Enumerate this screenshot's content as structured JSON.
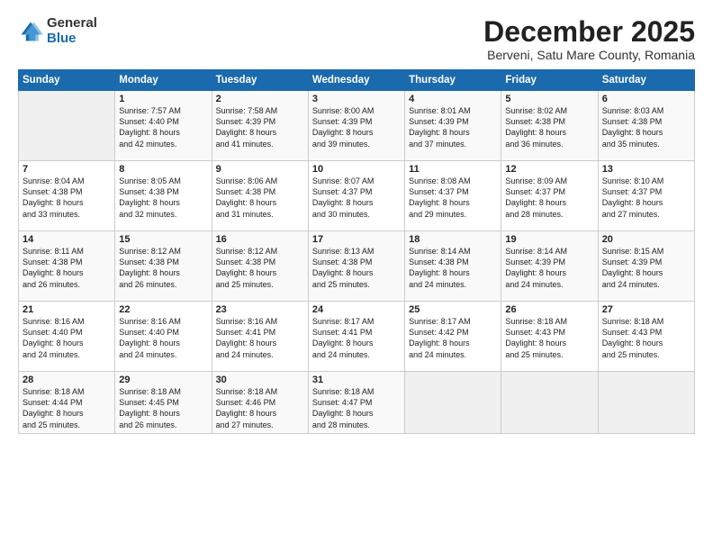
{
  "header": {
    "logo_general": "General",
    "logo_blue": "Blue",
    "month_title": "December 2025",
    "location": "Berveni, Satu Mare County, Romania"
  },
  "days_of_week": [
    "Sunday",
    "Monday",
    "Tuesday",
    "Wednesday",
    "Thursday",
    "Friday",
    "Saturday"
  ],
  "weeks": [
    [
      {
        "date": "",
        "text": ""
      },
      {
        "date": "1",
        "text": "Sunrise: 7:57 AM\nSunset: 4:40 PM\nDaylight: 8 hours\nand 42 minutes."
      },
      {
        "date": "2",
        "text": "Sunrise: 7:58 AM\nSunset: 4:39 PM\nDaylight: 8 hours\nand 41 minutes."
      },
      {
        "date": "3",
        "text": "Sunrise: 8:00 AM\nSunset: 4:39 PM\nDaylight: 8 hours\nand 39 minutes."
      },
      {
        "date": "4",
        "text": "Sunrise: 8:01 AM\nSunset: 4:39 PM\nDaylight: 8 hours\nand 37 minutes."
      },
      {
        "date": "5",
        "text": "Sunrise: 8:02 AM\nSunset: 4:38 PM\nDaylight: 8 hours\nand 36 minutes."
      },
      {
        "date": "6",
        "text": "Sunrise: 8:03 AM\nSunset: 4:38 PM\nDaylight: 8 hours\nand 35 minutes."
      }
    ],
    [
      {
        "date": "7",
        "text": "Sunrise: 8:04 AM\nSunset: 4:38 PM\nDaylight: 8 hours\nand 33 minutes."
      },
      {
        "date": "8",
        "text": "Sunrise: 8:05 AM\nSunset: 4:38 PM\nDaylight: 8 hours\nand 32 minutes."
      },
      {
        "date": "9",
        "text": "Sunrise: 8:06 AM\nSunset: 4:38 PM\nDaylight: 8 hours\nand 31 minutes."
      },
      {
        "date": "10",
        "text": "Sunrise: 8:07 AM\nSunset: 4:37 PM\nDaylight: 8 hours\nand 30 minutes."
      },
      {
        "date": "11",
        "text": "Sunrise: 8:08 AM\nSunset: 4:37 PM\nDaylight: 8 hours\nand 29 minutes."
      },
      {
        "date": "12",
        "text": "Sunrise: 8:09 AM\nSunset: 4:37 PM\nDaylight: 8 hours\nand 28 minutes."
      },
      {
        "date": "13",
        "text": "Sunrise: 8:10 AM\nSunset: 4:37 PM\nDaylight: 8 hours\nand 27 minutes."
      }
    ],
    [
      {
        "date": "14",
        "text": "Sunrise: 8:11 AM\nSunset: 4:38 PM\nDaylight: 8 hours\nand 26 minutes."
      },
      {
        "date": "15",
        "text": "Sunrise: 8:12 AM\nSunset: 4:38 PM\nDaylight: 8 hours\nand 26 minutes."
      },
      {
        "date": "16",
        "text": "Sunrise: 8:12 AM\nSunset: 4:38 PM\nDaylight: 8 hours\nand 25 minutes."
      },
      {
        "date": "17",
        "text": "Sunrise: 8:13 AM\nSunset: 4:38 PM\nDaylight: 8 hours\nand 25 minutes."
      },
      {
        "date": "18",
        "text": "Sunrise: 8:14 AM\nSunset: 4:38 PM\nDaylight: 8 hours\nand 24 minutes."
      },
      {
        "date": "19",
        "text": "Sunrise: 8:14 AM\nSunset: 4:39 PM\nDaylight: 8 hours\nand 24 minutes."
      },
      {
        "date": "20",
        "text": "Sunrise: 8:15 AM\nSunset: 4:39 PM\nDaylight: 8 hours\nand 24 minutes."
      }
    ],
    [
      {
        "date": "21",
        "text": "Sunrise: 8:16 AM\nSunset: 4:40 PM\nDaylight: 8 hours\nand 24 minutes."
      },
      {
        "date": "22",
        "text": "Sunrise: 8:16 AM\nSunset: 4:40 PM\nDaylight: 8 hours\nand 24 minutes."
      },
      {
        "date": "23",
        "text": "Sunrise: 8:16 AM\nSunset: 4:41 PM\nDaylight: 8 hours\nand 24 minutes."
      },
      {
        "date": "24",
        "text": "Sunrise: 8:17 AM\nSunset: 4:41 PM\nDaylight: 8 hours\nand 24 minutes."
      },
      {
        "date": "25",
        "text": "Sunrise: 8:17 AM\nSunset: 4:42 PM\nDaylight: 8 hours\nand 24 minutes."
      },
      {
        "date": "26",
        "text": "Sunrise: 8:18 AM\nSunset: 4:43 PM\nDaylight: 8 hours\nand 25 minutes."
      },
      {
        "date": "27",
        "text": "Sunrise: 8:18 AM\nSunset: 4:43 PM\nDaylight: 8 hours\nand 25 minutes."
      }
    ],
    [
      {
        "date": "28",
        "text": "Sunrise: 8:18 AM\nSunset: 4:44 PM\nDaylight: 8 hours\nand 25 minutes."
      },
      {
        "date": "29",
        "text": "Sunrise: 8:18 AM\nSunset: 4:45 PM\nDaylight: 8 hours\nand 26 minutes."
      },
      {
        "date": "30",
        "text": "Sunrise: 8:18 AM\nSunset: 4:46 PM\nDaylight: 8 hours\nand 27 minutes."
      },
      {
        "date": "31",
        "text": "Sunrise: 8:18 AM\nSunset: 4:47 PM\nDaylight: 8 hours\nand 28 minutes."
      },
      {
        "date": "",
        "text": ""
      },
      {
        "date": "",
        "text": ""
      },
      {
        "date": "",
        "text": ""
      }
    ]
  ]
}
